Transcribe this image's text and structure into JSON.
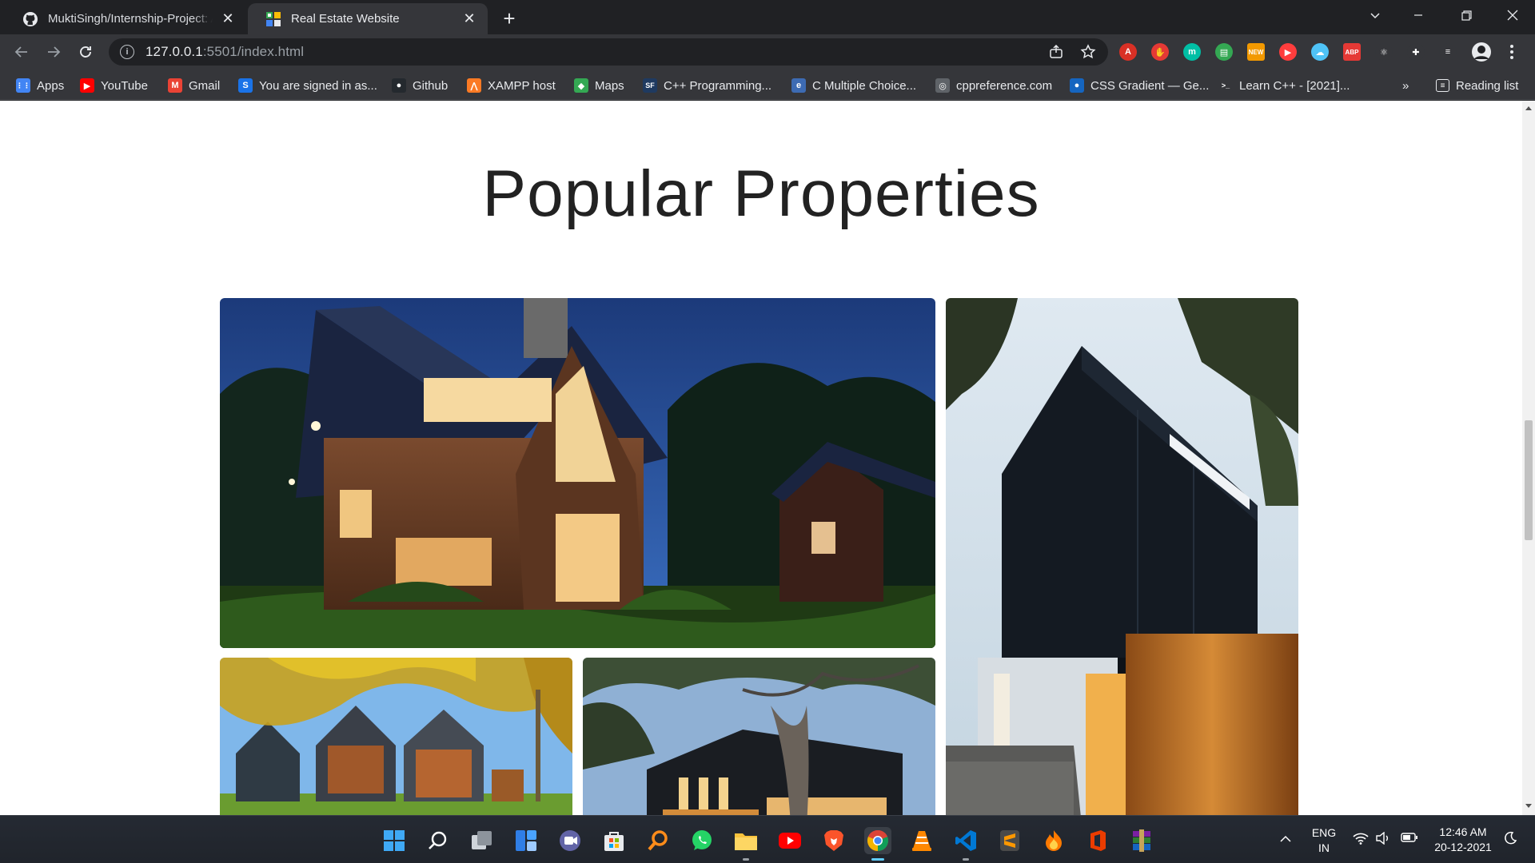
{
  "browser": {
    "tabs": [
      {
        "title": "MuktiSingh/Internship-Project: A",
        "active": false
      },
      {
        "title": "Real Estate Website",
        "active": true
      }
    ],
    "url_host": "127.0.0.1",
    "url_rest": ":5501/index.html",
    "extensions": [
      {
        "name": "pdf-icon",
        "glyph": "A",
        "color": "#d93025"
      },
      {
        "name": "shield-icon",
        "glyph": "✋",
        "color": "#e53935"
      },
      {
        "name": "m-icon",
        "glyph": "m",
        "color": "#00bfa5"
      },
      {
        "name": "printer-icon",
        "glyph": "▤",
        "color": "#34a853"
      },
      {
        "name": "new-badge-icon",
        "glyph": "NEW",
        "color": "#f29900"
      },
      {
        "name": "play-icon",
        "glyph": "▶",
        "color": "#ff3d3d"
      },
      {
        "name": "cloud-icon",
        "glyph": "☁",
        "color": "#4fc3f7"
      },
      {
        "name": "adblock-icon",
        "glyph": "ABP",
        "color": "#e53935"
      },
      {
        "name": "react-icon",
        "glyph": "⚛",
        "color": "#35363a"
      },
      {
        "name": "puzzle-icon",
        "glyph": "✚",
        "color": "#35363a"
      },
      {
        "name": "media-icon",
        "glyph": "≡",
        "color": "#35363a"
      }
    ],
    "bookmarks": [
      {
        "name": "bookmark-apps",
        "label": "Apps",
        "icon": "apps-grid-icon",
        "color": "#4285f4",
        "glyph": "⋮⋮"
      },
      {
        "name": "bookmark-youtube",
        "label": "YouTube",
        "icon": "youtube-icon",
        "color": "#ff0000",
        "glyph": "▶"
      },
      {
        "name": "bookmark-gmail",
        "label": "Gmail",
        "icon": "gmail-icon",
        "color": "#ea4335",
        "glyph": "M"
      },
      {
        "name": "bookmark-signed-in",
        "label": "You are signed in as...",
        "icon": "s-icon",
        "color": "#1a73e8",
        "glyph": "S"
      },
      {
        "name": "bookmark-github",
        "label": "Github",
        "icon": "github-icon",
        "color": "#24292e",
        "glyph": "●"
      },
      {
        "name": "bookmark-xampp",
        "label": "XAMPP host",
        "icon": "xampp-icon",
        "color": "#fb7a24",
        "glyph": "⋀"
      },
      {
        "name": "bookmark-maps",
        "label": "Maps",
        "icon": "maps-icon",
        "color": "#34a853",
        "glyph": "◆"
      },
      {
        "name": "bookmark-cpp",
        "label": "C++ Programming...",
        "icon": "sf-icon",
        "color": "#1f3a60",
        "glyph": "SF"
      },
      {
        "name": "bookmark-cmcq",
        "label": "C Multiple Choice...",
        "icon": "c-icon",
        "color": "#3d6bb3",
        "glyph": "e"
      },
      {
        "name": "bookmark-cppref",
        "label": "cppreference.com",
        "icon": "globe-icon",
        "color": "#5f6368",
        "glyph": "◎"
      },
      {
        "name": "bookmark-css-gradient",
        "label": "CSS Gradient — Ge...",
        "icon": "gradient-icon",
        "color": "#1565c0",
        "glyph": "●"
      },
      {
        "name": "bookmark-learn-cpp",
        "label": "Learn C++ - [2021]...",
        "icon": "terminal-icon",
        "color": "#35363a",
        "glyph": ">_"
      }
    ],
    "more_bookmarks": "»",
    "reading_list": "Reading list"
  },
  "page": {
    "heading": "Popular Properties"
  },
  "taskbar": {
    "lang_top": "ENG",
    "lang_bottom": "IN",
    "time": "12:46 AM",
    "date": "20-12-2021"
  }
}
